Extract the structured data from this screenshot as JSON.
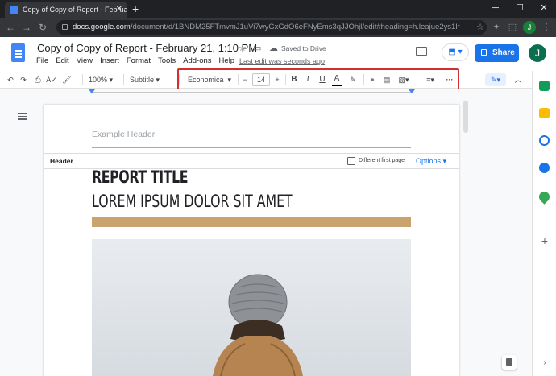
{
  "browser": {
    "tab_title": "Copy of Copy of Report - Februa",
    "tab_close": "✕",
    "new_tab": "+",
    "url_host": "docs.google.com",
    "url_path": "/document/d/1BNDM25FTmvmJ1uVi7wyGxGdO6eFNyEms3qJJOhjl/edit#heading=h.leajue2ys1lr",
    "profile_initial": "J"
  },
  "doc": {
    "title": "Copy of Copy of Report - February 21, 1:10 PM",
    "saved_status": "Saved to Drive",
    "last_edit": "Last edit was seconds ago",
    "menus": [
      "File",
      "Edit",
      "View",
      "Insert",
      "Format",
      "Tools",
      "Add-ons",
      "Help"
    ],
    "share_label": "Share",
    "avatar_initial": "J"
  },
  "toolbar": {
    "zoom": "100%",
    "style": "Subtitle",
    "font": "Economica",
    "font_size": "14",
    "minus": "−",
    "plus": "+",
    "bold": "B",
    "italic": "I",
    "underline": "U",
    "text_color": "A",
    "more": "···"
  },
  "page": {
    "header_placeholder": "Example Header",
    "header_label": "Header",
    "different_first_page": "Different first page",
    "options_label": "Options ▾",
    "report_title": "REPORT TITLE",
    "subtitle": "LOREM IPSUM DOLOR SIT AMET"
  },
  "colors": {
    "accent": "#1a73e8",
    "highlight_box": "#d32f2f",
    "tan": "#c9a26e"
  }
}
